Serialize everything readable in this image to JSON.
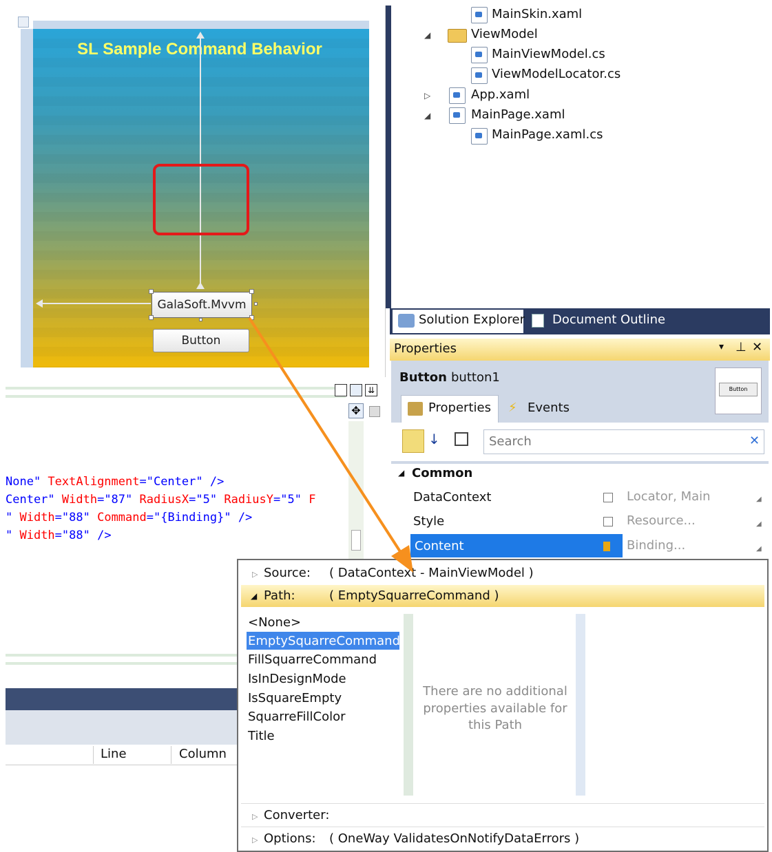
{
  "designer": {
    "app_title": "SL Sample Command Behavior",
    "selected_button_label": "GalaSoft.Mvvm",
    "button_label": "Button"
  },
  "xaml": {
    "lines": [
      [
        {
          "t": "None\"",
          "c": "q"
        },
        {
          "t": " TextAlignment",
          "c": "a"
        },
        {
          "t": "=\"Center\"",
          "c": "q"
        },
        {
          "t": " />",
          "c": "p"
        }
      ],
      [
        {
          "t": "Center\"",
          "c": "q"
        },
        {
          "t": " Width",
          "c": "a"
        },
        {
          "t": "=\"87\"",
          "c": "q"
        },
        {
          "t": " RadiusX",
          "c": "a"
        },
        {
          "t": "=\"5\"",
          "c": "q"
        },
        {
          "t": " RadiusY",
          "c": "a"
        },
        {
          "t": "=\"5\"",
          "c": "q"
        },
        {
          "t": " F",
          "c": "a"
        }
      ],
      [
        {
          "t": "\"",
          "c": "q"
        },
        {
          "t": " Width",
          "c": "a"
        },
        {
          "t": "=\"88\"",
          "c": "q"
        },
        {
          "t": " Command",
          "c": "a"
        },
        {
          "t": "=\"{Binding}\"",
          "c": "q"
        },
        {
          "t": " />",
          "c": "p"
        }
      ],
      [
        {
          "t": "\"",
          "c": "q"
        },
        {
          "t": " Width",
          "c": "a"
        },
        {
          "t": "=\"88\"",
          "c": "q"
        },
        {
          "t": " />",
          "c": "p"
        }
      ]
    ]
  },
  "explorer": {
    "items": [
      "MainSkin.xaml",
      "ViewModel",
      "MainViewModel.cs",
      "ViewModelLocator.cs",
      "App.xaml",
      "MainPage.xaml",
      "MainPage.xaml.cs"
    ],
    "tab_solution": "Solution Explorer",
    "tab_outline": "Document Outline"
  },
  "properties": {
    "title": "Properties",
    "object_type": "Button",
    "object_name": "button1",
    "preview_label": "Button",
    "tab_properties": "Properties",
    "tab_events": "Events",
    "search_placeholder": "Search",
    "category": "Common",
    "rows": [
      {
        "name": "DataContext",
        "value": "Locator, Main"
      },
      {
        "name": "Style",
        "value": "Resource..."
      },
      {
        "name": "Content",
        "value": "Binding..."
      }
    ]
  },
  "binding": {
    "source_label": "Source:",
    "source_value": "( DataContext - MainViewModel )",
    "path_label": "Path:",
    "path_value": "( EmptySquarreCommand )",
    "path_items": [
      "<None>",
      "EmptySquarreCommand",
      "FillSquarreCommand",
      "IsInDesignMode",
      "IsSquareEmpty",
      "SquarreFillColor",
      "Title"
    ],
    "no_props_line1": "There are no additional",
    "no_props_line2": "properties available for",
    "no_props_line3": "this Path",
    "converter_label": "Converter:",
    "options_label": "Options:",
    "options_value": "( OneWay ValidatesOnNotifyDataErrors )"
  },
  "errorlist": {
    "col_line": "Line",
    "col_column": "Column"
  },
  "colors": {
    "accent_orange": "#f6901e",
    "selection_blue": "#1e7ae6",
    "red_square": "#e41919"
  }
}
